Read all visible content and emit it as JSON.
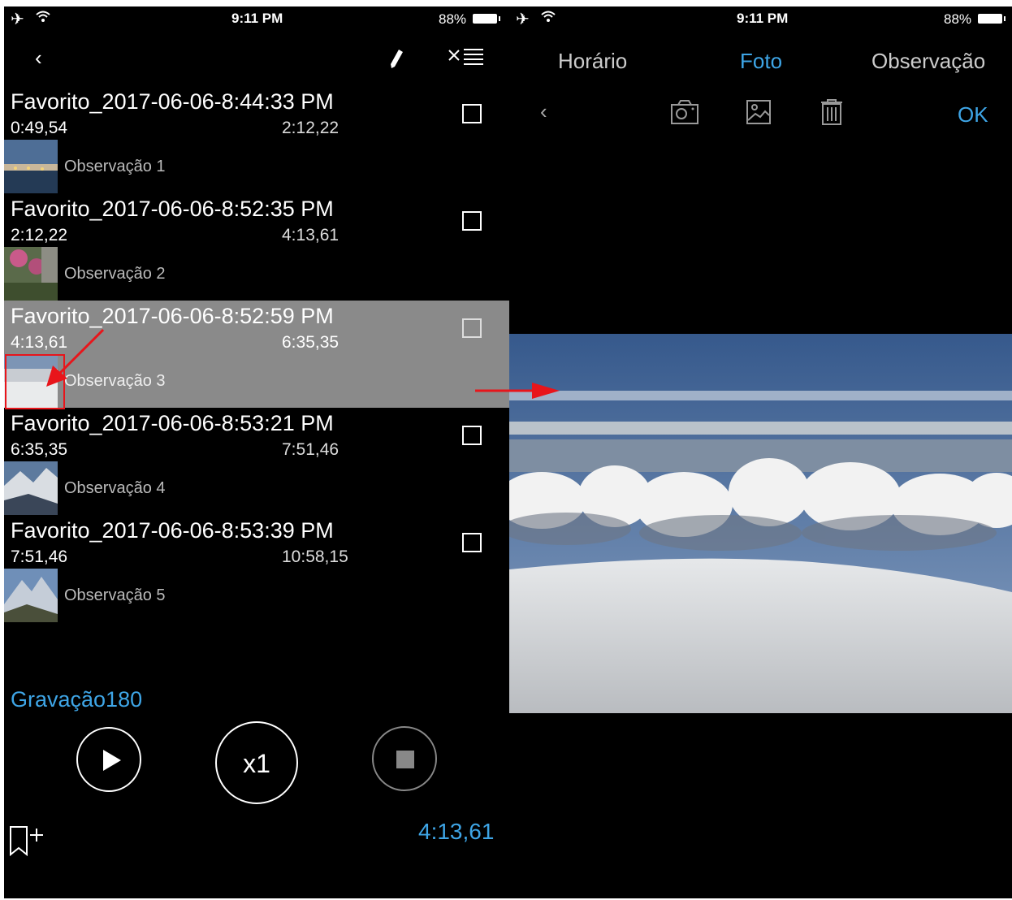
{
  "status": {
    "time": "9:11 PM",
    "battery": "88%"
  },
  "left": {
    "rows": [
      {
        "title": "Favorito_2017-06-06-8:44:33 PM",
        "start": "0:49,54",
        "end": "2:12,22",
        "obs": "Observação 1"
      },
      {
        "title": "Favorito_2017-06-06-8:52:35 PM",
        "start": "2:12,22",
        "end": "4:13,61",
        "obs": "Observação 2"
      },
      {
        "title": "Favorito_2017-06-06-8:52:59 PM",
        "start": "4:13,61",
        "end": "6:35,35",
        "obs": "Observação 3"
      },
      {
        "title": "Favorito_2017-06-06-8:53:21 PM",
        "start": "6:35,35",
        "end": "7:51,46",
        "obs": "Observação 4"
      },
      {
        "title": "Favorito_2017-06-06-8:53:39 PM",
        "start": "7:51,46",
        "end": "10:58,15",
        "obs": "Observação 5"
      }
    ],
    "recording": "Gravação180",
    "speed": "x1",
    "current_time": "4:13,61"
  },
  "right": {
    "tabs": [
      "Horário",
      "Foto",
      "Observação"
    ],
    "active_tab": "Foto",
    "ok": "OK"
  },
  "colors": {
    "accent": "#3ea5e6",
    "selected_row": "#8a8a8a",
    "annotation": "#e8151b"
  },
  "icons": [
    "airplane-icon",
    "wifi-icon",
    "back-chevron-icon",
    "pencil-icon",
    "clear-list-icon",
    "checkbox-icon",
    "play-icon",
    "stop-icon",
    "bookmark-add-icon",
    "camera-icon",
    "gallery-icon",
    "trash-icon"
  ]
}
